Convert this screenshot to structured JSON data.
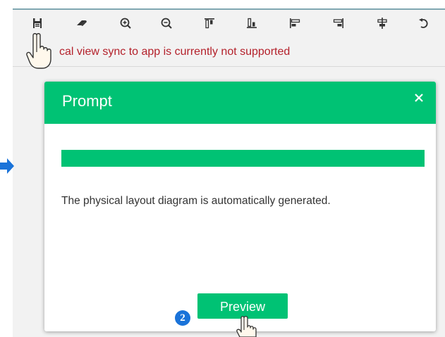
{
  "toolbar": {
    "buttons": [
      {
        "id": "save",
        "icon": "save-icon"
      },
      {
        "id": "eraser",
        "icon": "eraser-icon"
      },
      {
        "id": "zoom-in",
        "icon": "zoom-in-icon"
      },
      {
        "id": "zoom-out",
        "icon": "zoom-out-icon"
      },
      {
        "id": "align-top",
        "icon": "align-top-icon"
      },
      {
        "id": "align-bottom",
        "icon": "align-bottom-icon"
      },
      {
        "id": "align-left",
        "icon": "align-left-icon"
      },
      {
        "id": "align-right",
        "icon": "align-right-icon"
      },
      {
        "id": "align-center",
        "icon": "align-center-icon"
      },
      {
        "id": "undo",
        "icon": "undo-icon"
      }
    ]
  },
  "warning": {
    "text": "cal view sync to app is currently not supported",
    "color": "#b4212b"
  },
  "modal": {
    "title": "Prompt",
    "close_icon": "close-icon",
    "progress_fraction": 1.0,
    "message": "The physical layout diagram is automatically generated.",
    "preview_label": "Preview"
  },
  "annotations": {
    "step_number": "2"
  },
  "colors": {
    "accent": "#00c274",
    "badge": "#1a73d9",
    "toolbar_icon": "#333333"
  }
}
